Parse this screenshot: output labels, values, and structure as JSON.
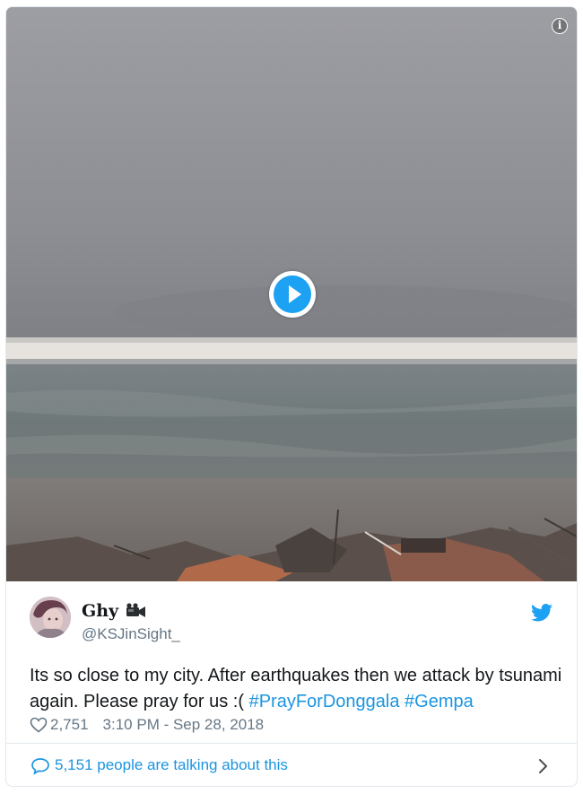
{
  "media": {
    "info_icon": "info-icon",
    "play_icon": "play-icon"
  },
  "tweet": {
    "author": {
      "name": "Ghy",
      "emoji_icon": "video-camera-icon",
      "handle": "@KSJinSight_"
    },
    "brand_icon": "twitter-bird-icon",
    "text_plain": "Its so close to my city. After earthquakes then we attack by tsunami again. Please pray for us :(",
    "hashtags": [
      "#PrayForDonggala",
      "#Gempa"
    ],
    "likes": "2,751",
    "timestamp": "3:10 PM - Sep 28, 2018"
  },
  "footer": {
    "talking_text": "5,151 people are talking about this"
  },
  "colors": {
    "accent": "#1b95e0",
    "play": "#1da1f2",
    "muted": "#657786",
    "border": "#e1e8ed"
  }
}
